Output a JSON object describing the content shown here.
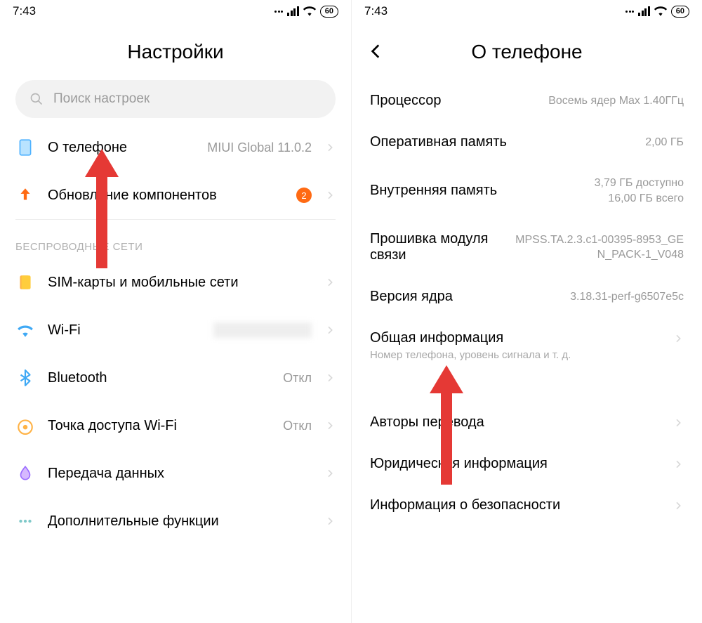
{
  "status": {
    "time": "7:43",
    "battery": "60"
  },
  "left": {
    "title": "Настройки",
    "search_placeholder": "Поиск настроек",
    "rows": {
      "about_phone": {
        "label": "О телефоне",
        "value": "MIUI Global 11.0.2"
      },
      "update_components": {
        "label": "Обновление компонентов",
        "badge": "2"
      }
    },
    "section_wireless": "БЕСПРОВОДНЫЕ СЕТИ",
    "wireless": {
      "sim": {
        "label": "SIM-карты и мобильные сети"
      },
      "wifi": {
        "label": "Wi-Fi"
      },
      "bluetooth": {
        "label": "Bluetooth",
        "value": "Откл"
      },
      "hotspot": {
        "label": "Точка доступа Wi-Fi",
        "value": "Откл"
      },
      "data": {
        "label": "Передача данных"
      },
      "more": {
        "label": "Дополнительные функции"
      }
    }
  },
  "right": {
    "title": "О телефоне",
    "items": {
      "cpu": {
        "label": "Процессор",
        "value": "Восемь ядер Max 1.40ГГц"
      },
      "ram": {
        "label": "Оперативная память",
        "value": "2,00 ГБ"
      },
      "storage": {
        "label": "Внутренняя память",
        "value": "3,79 ГБ доступно\n16,00 ГБ всего"
      },
      "modem": {
        "label": "Прошивка модуля связи",
        "value": "MPSS.TA.2.3.c1-00395-8953_GEN_PACK-1_V048"
      },
      "kernel": {
        "label": "Версия ядра",
        "value": "3.18.31-perf-g6507e5c"
      },
      "general": {
        "label": "Общая информация",
        "subtitle": "Номер телефона, уровень сигнала и т. д."
      },
      "translators": {
        "label": "Авторы перевода"
      },
      "legal": {
        "label": "Юридическая информация"
      },
      "security": {
        "label": "Информация о безопасности"
      }
    }
  }
}
